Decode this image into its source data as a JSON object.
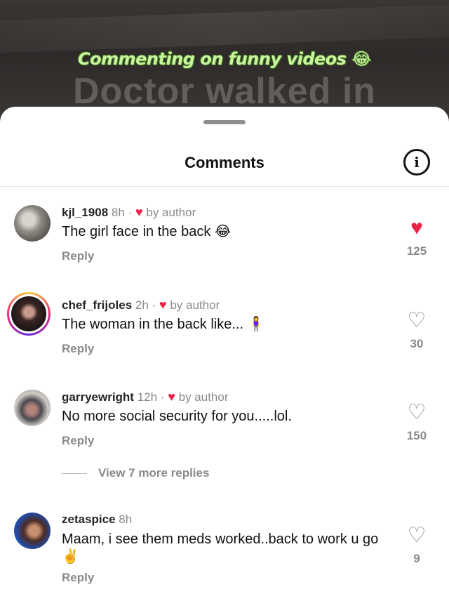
{
  "video": {
    "caption": "Commenting on funny videos",
    "caption_emoji": "😂",
    "big_text": "Doctor walked in"
  },
  "sheet": {
    "title": "Comments",
    "info_icon": "info-icon"
  },
  "comments": [
    {
      "username": "kjl_1908",
      "time": "8h",
      "author_badge": "by author",
      "text": "The girl face in the back 😂",
      "reply_label": "Reply",
      "likes": "125",
      "liked": true
    },
    {
      "username": "chef_frijoles",
      "time": "2h",
      "author_badge": "by author",
      "text": "The woman in the back like... 🧍‍♀️",
      "reply_label": "Reply",
      "likes": "30",
      "liked": false
    },
    {
      "username": "garryewright",
      "time": "12h",
      "author_badge": "by author",
      "text": "No more social security for you.....lol.",
      "reply_label": "Reply",
      "likes": "150",
      "liked": false
    },
    {
      "username": "zetaspice",
      "time": "8h",
      "author_badge": "",
      "text": "Maam, i see them meds worked..back to work u go ✌️",
      "reply_label": "Reply",
      "likes": "9",
      "liked": false
    }
  ],
  "view_more_replies": "View 7 more replies",
  "colors": {
    "heart": "#ed2146",
    "muted": "#8a8a8a",
    "text": "#111111"
  }
}
